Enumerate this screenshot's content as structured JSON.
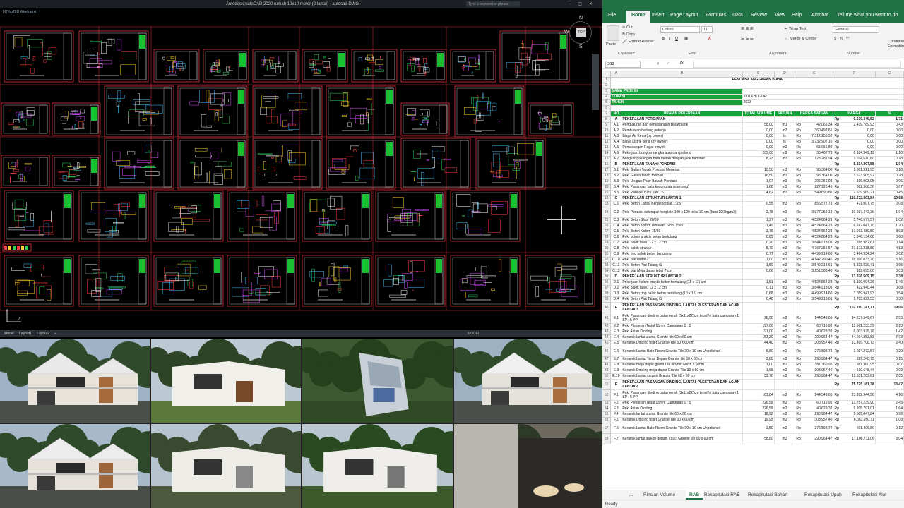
{
  "autocad": {
    "title": "Autodesk AutoCAD 2020   rumah 10x10 meter (2 lantai) - autocad DWG",
    "search_placeholder": "Type a keyword or phrase",
    "viewport_label": "[-][Top][2D Wireframe]",
    "viewcube": {
      "top": "TOP",
      "north": "N",
      "west": "W",
      "south": "S"
    },
    "layout_tabs": [
      "Model",
      "Layout1",
      "Layout2",
      "+"
    ],
    "status_label": "MODEL",
    "colors": {
      "sheet_border": "#e0303a",
      "background": "#000000"
    }
  },
  "excel": {
    "ribbon_tabs": [
      "File",
      "Home",
      "Insert",
      "Page Layout",
      "Formulas",
      "Data",
      "Review",
      "View",
      "Help",
      "Acrobat",
      "Tell me what you want to do"
    ],
    "active_tab": "Home",
    "clipboard": {
      "paste": "Paste",
      "cut": "Cut",
      "copy": "Copy",
      "format_painter": "Format Painter",
      "group": "Clipboard"
    },
    "font": {
      "name": "Calibri",
      "size": "11",
      "group": "Font"
    },
    "alignment": {
      "wrap": "Wrap Text",
      "merge": "Merge & Center",
      "group": "Alignment"
    },
    "number": {
      "format": "General",
      "group": "Number"
    },
    "conditional": "Conditional Formatting",
    "name_box": "S12",
    "fx": "fx",
    "columns": [
      "",
      "A",
      "B",
      "C",
      "D",
      "E",
      "F",
      "G"
    ],
    "title": "RENCANA ANGGARAN BIAYA",
    "project": [
      {
        "label": "NAMA PROYEK",
        "value": ""
      },
      {
        "label": "LOKASI",
        "value": "KOTA BOGOR"
      },
      {
        "label": "TAHUN",
        "value": "2023"
      }
    ],
    "table_header": {
      "no": "NO",
      "uraian": "URAIAN PEKERJAAN",
      "vol": "TOTAL VOLUME",
      "sat": "SATUAN",
      "hs": "HARGA SATUAN",
      "harga": "HARGA",
      "pct": "%"
    },
    "rows": [
      {
        "r": "8",
        "a": "A",
        "b": "PEKERJAAN PERSIAPAN",
        "c": "",
        "d": "",
        "e1": "",
        "e": "",
        "f1": "Rp",
        "f": "9.639.349,52",
        "g": "1,71",
        "sec": true
      },
      {
        "r": "9",
        "a": "A.1",
        "b": "Pengukuran dan pemasangan Bouwplank",
        "c": "58,00",
        "d": "m1",
        "e1": "Rp",
        "e": "42.065,34",
        "f1": "Rp",
        "f": "2.439.789,93",
        "g": "0,43"
      },
      {
        "r": "10",
        "a": "A.2",
        "b": "Pembuatan bedeng pekerja",
        "c": "0,00",
        "d": "m2",
        "e1": "Rp",
        "e": "360.492,61",
        "f1": "Rp",
        "f": "0,00",
        "g": "0,00"
      },
      {
        "r": "11",
        "a": "A.3",
        "b": "Biaya Air Kerja (by owner)",
        "c": "0,00",
        "d": "ls",
        "e1": "Rp",
        "e": "7.312.255,52",
        "f1": "Rp",
        "f": "0,00",
        "g": "0,00"
      },
      {
        "r": "12",
        "a": "A.4",
        "b": "Biaya Listrik kerja (by owner)",
        "c": "0,00",
        "d": "ls",
        "e1": "Rp",
        "e": "3.732.907,10",
        "f1": "Rp",
        "f": "0,00",
        "g": "0,00"
      },
      {
        "r": "13",
        "a": "A.5",
        "b": "Pemasangan Pagar proyek",
        "c": "0,00",
        "d": "m2",
        "e1": "Rp",
        "e": "65.066,89",
        "f1": "Rp",
        "f": "0,00",
        "g": "0,00"
      },
      {
        "r": "14",
        "a": "A.6",
        "b": "Pekerjaan bongkar rangka atap dan plafond",
        "c": "203,00",
        "d": "m2",
        "e1": "Rp",
        "e": "30.467,73",
        "f1": "Rp",
        "f": "6.184.949,19",
        "g": "1,10"
      },
      {
        "r": "15",
        "a": "A.7",
        "b": "Bongkar pasangan bata merah dengan jack hammer",
        "c": "8,23",
        "d": "m3",
        "e1": "Rp",
        "e": "123.281,94",
        "f1": "Rp",
        "f": "1.014.610,60",
        "g": "0,18"
      },
      {
        "r": "16",
        "a": "B",
        "b": "PEKERJAAN TANAH+PONDASI",
        "c": "",
        "d": "",
        "e1": "",
        "e": "",
        "f1": "Rp",
        "f": "5.814.297,58",
        "g": "1,04",
        "sec": true
      },
      {
        "r": "17",
        "a": "B.1",
        "b": "Pek. Galian Tanah Pondasi Menerus",
        "c": "10,50",
        "d": "m3",
        "e1": "Rp",
        "e": "95.364,00",
        "f1": "Rp",
        "f": "1.001.321,95",
        "g": "0,18"
      },
      {
        "r": "18",
        "a": "B.2",
        "b": "Pek. Galian tanah footplat",
        "c": "16,50",
        "d": "m3",
        "e1": "Rp",
        "e": "95.364,00",
        "f1": "Rp",
        "f": "1.573.505,92",
        "g": "0,28"
      },
      {
        "r": "19",
        "a": "B.3",
        "b": "Pek. Urugan Pasir Bawah Pondasi",
        "c": "1,07",
        "d": "m3",
        "e1": "Rp",
        "e": "296.256,03",
        "f1": "Rp",
        "f": "316.993,95",
        "g": "0,06"
      },
      {
        "r": "20",
        "a": "B.4",
        "b": "Pek. Pasangan batu kosong(aanstamping)",
        "c": "1,68",
        "d": "m3",
        "e1": "Rp",
        "e": "227.920,45",
        "f1": "Rp",
        "f": "382.906,36",
        "g": "0,07"
      },
      {
        "r": "21",
        "a": "B.5",
        "b": "Pek. Pondasi Batu kali 1:5",
        "c": "4,62",
        "d": "m3",
        "e1": "Rp",
        "e": "549.690,80",
        "f1": "Rp",
        "f": "2.539.569,21",
        "g": "0,45"
      },
      {
        "r": "22",
        "a": "C",
        "b": "PEKERJAAN STRUKTUR LANTAI 1",
        "c": "",
        "d": "",
        "e1": "",
        "e": "",
        "f1": "Rp",
        "f": "110.672.801,84",
        "g": "19,68",
        "sec": true
      },
      {
        "r": "23",
        "a": "C.1",
        "b": "Pek. Beton Lantai Kerja footplat 1:3:5",
        "c": "0,55",
        "d": "m3",
        "e1": "Rp",
        "e": "856.577,73",
        "f1": "Rp",
        "f": "471.007,75",
        "g": "0,08"
      },
      {
        "r": "24",
        "a": "C.2",
        "b": "Pek. Pondasi setempat footplate 100 x 100 tebal 30 cm (besi 100 kg/m3)",
        "c": "2,75",
        "d": "m3",
        "e1": "Rp",
        "e": "3.977.252,13",
        "f1": "Rp",
        "f": "10.937.443,36",
        "g": "1,94",
        "tall": true
      },
      {
        "r": "25",
        "a": "C.3",
        "b": "Pek. Beton Sloof 20/30",
        "c": "1,27",
        "d": "m3",
        "e1": "Rp",
        "e": "4.524.864,23",
        "f1": "Rp",
        "f": "5.746.577,57",
        "g": "1,02"
      },
      {
        "r": "26",
        "a": "C.4",
        "b": "Pek. Beton Kolom Dibawah Sloof 15/60",
        "c": "1,49",
        "d": "m3",
        "e1": "Rp",
        "e": "4.524.864,23",
        "f1": "Rp",
        "f": "6.742.047,70",
        "g": "1,20"
      },
      {
        "r": "27",
        "a": "C.5",
        "b": "Pek. Beton Kolom 15/60",
        "c": "3,76",
        "d": "m3",
        "e1": "Rp",
        "e": "4.524.864,23",
        "f1": "Rp",
        "f": "17.013.489,50",
        "g": "3,03"
      },
      {
        "r": "28",
        "a": "C.6",
        "b": "Pek. kolom praktis beton bertulang",
        "c": "0,85",
        "d": "m3",
        "e1": "Rp",
        "e": "4.524.864,23",
        "f1": "Rp",
        "f": "3.846.134,60",
        "g": "0,68"
      },
      {
        "r": "29",
        "a": "C.7",
        "b": "Pek. balok latelu 12 x 12 cm",
        "c": "0,20",
        "d": "m3",
        "e1": "Rp",
        "e": "3.844.913,05",
        "f1": "Rp",
        "f": "768.982,61",
        "g": "0,14"
      },
      {
        "r": "30",
        "a": "C.8",
        "b": "Pek. balok struktur",
        "c": "5,70",
        "d": "m3",
        "e1": "Rp",
        "e": "4.767.256,57",
        "f1": "Rp",
        "f": "27.173.235,89",
        "g": "4,83"
      },
      {
        "r": "31",
        "a": "C.9",
        "b": "Pek. ring balok beton bertulang",
        "c": "0,77",
        "d": "m3",
        "e1": "Rp",
        "e": "4.499.914,60",
        "f1": "Rp",
        "f": "3.464.934,24",
        "g": "0,62"
      },
      {
        "r": "32",
        "a": "C.10",
        "b": "Pek. plat lantai 2",
        "c": "7,00",
        "d": "m3",
        "e1": "Rp",
        "e": "4.142.290,46",
        "f1": "Rp",
        "f": "28.996.033,20",
        "g": "5,16"
      },
      {
        "r": "33",
        "a": "C.11",
        "b": "Pek. Beton Plat Talang t1",
        "c": "1,50",
        "d": "m3",
        "e1": "Rp",
        "e": "3.549.213,61",
        "f1": "Rp",
        "f": "5.323.820,41",
        "g": "0,95"
      },
      {
        "r": "34",
        "a": "C.12",
        "b": "Pek. plat Meja dapur tebal 7 cm",
        "c": "0,06",
        "d": "m3",
        "e1": "Rp",
        "e": "3.151.583,40",
        "f1": "Rp",
        "f": "189.095,00",
        "g": "0,03"
      },
      {
        "r": "35",
        "a": "D",
        "b": "PEKERJAAN STRUKTUR LANTAI 2",
        "c": "",
        "d": "",
        "e1": "",
        "e": "",
        "f1": "Rp",
        "f": "13.376.509,15",
        "g": "2,38",
        "sec": true
      },
      {
        "r": "36",
        "a": "D.1",
        "b": "Pekerjaan kolom praktis beton bertulang (11 x 11) cm",
        "c": "1,81",
        "d": "m3",
        "e1": "Rp",
        "e": "4.524.864,23",
        "f1": "Rp",
        "f": "8.190.004,26",
        "g": "1,46"
      },
      {
        "r": "37",
        "a": "D.2",
        "b": "Pek. balok latelu 12 x 12 cm",
        "c": "0,11",
        "d": "m3",
        "e1": "Rp",
        "e": "3.844.913,05",
        "f1": "Rp",
        "f": "422.940,44",
        "g": "0,08"
      },
      {
        "r": "38",
        "a": "D.3",
        "b": "Pek. Beton ring balok beton bertulang (10 x 15) cm",
        "c": "0,68",
        "d": "m3",
        "e1": "Rp",
        "e": "4.499.914,60",
        "f1": "Rp",
        "f": "3.059.941,93",
        "g": "0,54"
      },
      {
        "r": "39",
        "a": "D.4",
        "b": "Pek. Beton Plat Talang t1",
        "c": "0,48",
        "d": "m3",
        "e1": "Rp",
        "e": "3.549.213,61",
        "f1": "Rp",
        "f": "1.703.622,53",
        "g": "0,30"
      },
      {
        "r": "40",
        "a": "E",
        "b": "PEKERJAAN PASANGAN DINDING, LANTAI, PLESTERAN DAN ACIAN LANTAI 1",
        "c": "",
        "d": "",
        "e1": "",
        "e": "",
        "f1": "Rp",
        "f": "107.180.141,71",
        "g": "19,06",
        "sec": true,
        "tall": true
      },
      {
        "r": "41",
        "a": "E.1",
        "b": "Pek. Pasangan dinding bata merah (5x11x22)cm tebal ½ batu campuran 1 SP : 5 PP",
        "c": "98,50",
        "d": "m2",
        "e1": "Rp",
        "e": "144.543,65",
        "f1": "Rp",
        "f": "14.237.549,67",
        "g": "2,53",
        "tall": true
      },
      {
        "r": "42",
        "a": "E.2",
        "b": "Pek. Plesteran Tebal 15mm Campuran 1 : 5",
        "c": "197,00",
        "d": "m2",
        "e1": "Rp",
        "e": "60.716,92",
        "f1": "Rp",
        "f": "11.961.233,39",
        "g": "2,13"
      },
      {
        "r": "43",
        "a": "E.3",
        "b": "Pek. Acian Dinding",
        "c": "197,00",
        "d": "m2",
        "e1": "Rp",
        "e": "40.629,32",
        "f1": "Rp",
        "f": "8.003.975,76",
        "g": "1,42"
      },
      {
        "r": "44",
        "a": "E.4",
        "b": "Keramik lantai utama Granite tile 60 x 60 cm",
        "c": "153,30",
        "d": "m2",
        "e1": "Rp",
        "e": "290.964,47",
        "f1": "Rp",
        "f": "44.604.853,83",
        "g": "7,93"
      },
      {
        "r": "45",
        "a": "E.5",
        "b": "Keramik Dinding toilet Granite Tile 30 x 60 cm",
        "c": "44,40",
        "d": "m2",
        "e1": "Rp",
        "e": "303.957,40",
        "f1": "Rp",
        "f": "13.495.708,73",
        "g": "2,40"
      },
      {
        "r": "46",
        "a": "E.6",
        "b": "Keramik Lantai Bath Room Granite Tile 30 x 30 cm Unpolished",
        "c": "5,80",
        "d": "m2",
        "e1": "Rp",
        "e": "276.598,72",
        "f1": "Rp",
        "f": "1.604.272,57",
        "g": "0,29",
        "tall": true
      },
      {
        "r": "47",
        "a": "E.7",
        "b": "Keramik Lantai Teras Depan Granite tile 60 x 60 cm",
        "c": "2,85",
        "d": "m2",
        "e1": "Rp",
        "e": "290.964,47",
        "f1": "Rp",
        "f": "829.248,75",
        "g": "0,15"
      },
      {
        "r": "48",
        "a": "E.8",
        "b": "Keramik meja dapur granit Tile ukuran 60cm x 60cm",
        "c": "1,00",
        "d": "m2",
        "e1": "Rp",
        "e": "381.360,95",
        "f1": "Rp",
        "f": "381.360,95",
        "g": "0,07"
      },
      {
        "r": "49",
        "a": "E.9",
        "b": "Keramik Dinding meja dapur Granite Tile 30 x 60 cm",
        "c": "1,68",
        "d": "m2",
        "e1": "Rp",
        "e": "303.957,40",
        "f1": "Rp",
        "f": "510.648,44",
        "g": "0,09"
      },
      {
        "r": "50",
        "a": "E.10",
        "b": "Keramik Lantai carport Granite Tile 60 x 60 cm",
        "c": "39,70",
        "d": "m2",
        "e1": "Rp",
        "e": "290.964,47",
        "f1": "Rp",
        "f": "11.551.289,61",
        "g": "2,05"
      },
      {
        "r": "51",
        "a": "F",
        "b": "PEKERJAAN PASANGAN DINDING, LANTAI, PLESTERAN DAN ACIAN LANTAI 2",
        "c": "",
        "d": "",
        "e1": "",
        "e": "",
        "f1": "Rp",
        "f": "75.725.181,38",
        "g": "13,47",
        "sec": true,
        "tall": true
      },
      {
        "r": "52",
        "a": "F.1",
        "b": "Pek. Pasangan dinding bata merah (5x11x22)cm tebal ½ batu campuran 1 SP : 5 PP",
        "c": "161,84",
        "d": "m2",
        "e1": "Rp",
        "e": "144.543,65",
        "f1": "Rp",
        "f": "23.392.944,56",
        "g": "4,16",
        "tall": true
      },
      {
        "r": "53",
        "a": "F.2",
        "b": "Pek. Plesteran Tebal 15mm Campuran 1 : 5",
        "c": "226,58",
        "d": "m2",
        "e1": "Rp",
        "e": "60.716,92",
        "f1": "Rp",
        "f": "13.757.239,90",
        "g": "2,45"
      },
      {
        "r": "54",
        "a": "F.3",
        "b": "Pek. Acian Dinding",
        "c": "226,58",
        "d": "m2",
        "e1": "Rp",
        "e": "40.629,32",
        "f1": "Rp",
        "f": "9.205.791,01",
        "g": "1,64"
      },
      {
        "r": "55",
        "a": "F.4",
        "b": "Keramik lantai utama Granite tile 60 x 60 cm",
        "c": "18,92",
        "d": "m2",
        "e1": "Rp",
        "e": "290.964,47",
        "f1": "Rp",
        "f": "5.505.047,84",
        "g": "0,98"
      },
      {
        "r": "56",
        "a": "F.5",
        "b": "Keramik Dinding toilet Granite Tile 30 x 60 cm",
        "c": "19,95",
        "d": "m2",
        "e1": "Rp",
        "e": "303.957,40",
        "f1": "Rp",
        "f": "6.063.950,11",
        "g": "1,08"
      },
      {
        "r": "57",
        "a": "F.6",
        "b": "Keramik Lantai Bath Room Granite Tile 30 x 30 cm Unpolished",
        "c": "2,50",
        "d": "m2",
        "e1": "Rp",
        "e": "276.598,72",
        "f1": "Rp",
        "f": "691.496,80",
        "g": "0,12",
        "tall": true
      },
      {
        "r": "58",
        "a": "F.7",
        "b": "Keramik lantai balkon depan, r.cuci Granite tile 60 x 60 cm",
        "c": "58,80",
        "d": "m2",
        "e1": "Rp",
        "e": "290.964,47",
        "f1": "Rp",
        "f": "17.108.711,06",
        "g": "3,04",
        "tall": true
      }
    ],
    "sheet_tabs": [
      "...",
      "Rincian Volume",
      "RAB",
      "Rekapitulasi RAB",
      "Rekapitulasi Bahan",
      "Rekapitulasi Upah",
      "Rekapitulasi Alat"
    ],
    "active_sheet": "RAB",
    "status": "Ready",
    "colors": {
      "brand": "#217346",
      "header_green": "#16a13a"
    }
  }
}
